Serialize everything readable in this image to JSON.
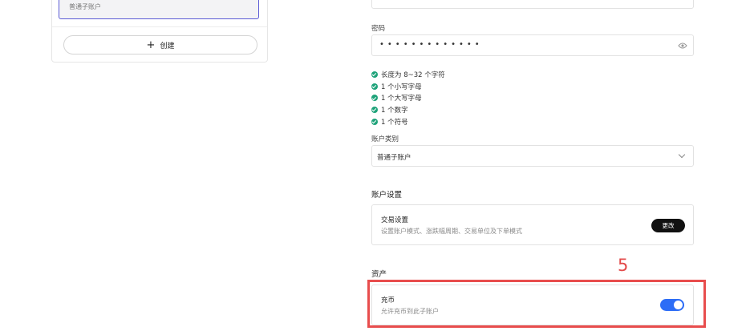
{
  "left_panel": {
    "selected_item": "普通子账户",
    "create_button_label": "创建"
  },
  "form": {
    "top_input_value": "",
    "password": {
      "label": "密码",
      "masked_value": "•••••••••••••"
    },
    "password_rules": [
      "长度为 8~32 个字符",
      "1 个小写字母",
      "1 个大写字母",
      "1 个数字",
      "1 个符号"
    ],
    "account_type": {
      "label": "账户类别",
      "value": "普通子账户"
    },
    "account_settings": {
      "section_title": "账户设置",
      "trade_settings": {
        "title": "交易设置",
        "description": "设置账户模式、涨跌幅周期、交易单位及下单模式",
        "button_label": "更改"
      }
    },
    "assets": {
      "section_title": "资产",
      "deposit": {
        "title": "充币",
        "description": "允许充币到此子账户",
        "enabled": true
      }
    }
  },
  "annotation": {
    "number": "5",
    "color": "#e84d4d"
  },
  "colors": {
    "check_green": "#1fa37a",
    "toggle_blue": "#2d6df6",
    "button_black": "#111111"
  }
}
